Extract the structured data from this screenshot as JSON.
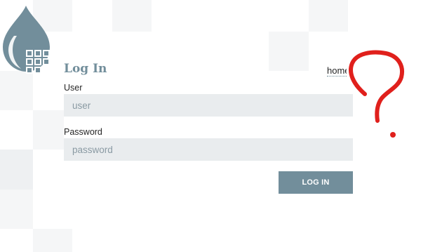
{
  "header": {
    "title": "Log In",
    "home_link": "home"
  },
  "form": {
    "user_label": "User",
    "user_placeholder": "user",
    "user_value": "",
    "password_label": "Password",
    "password_placeholder": "password",
    "password_value": "",
    "login_button": "LOG IN"
  },
  "colors": {
    "brand": "#728e9b",
    "input_background": "#e9ecee",
    "annotation": "#e0201c"
  },
  "icons": {
    "logo": "water-drop-grid-logo",
    "annotation": "question-mark-scribble"
  }
}
